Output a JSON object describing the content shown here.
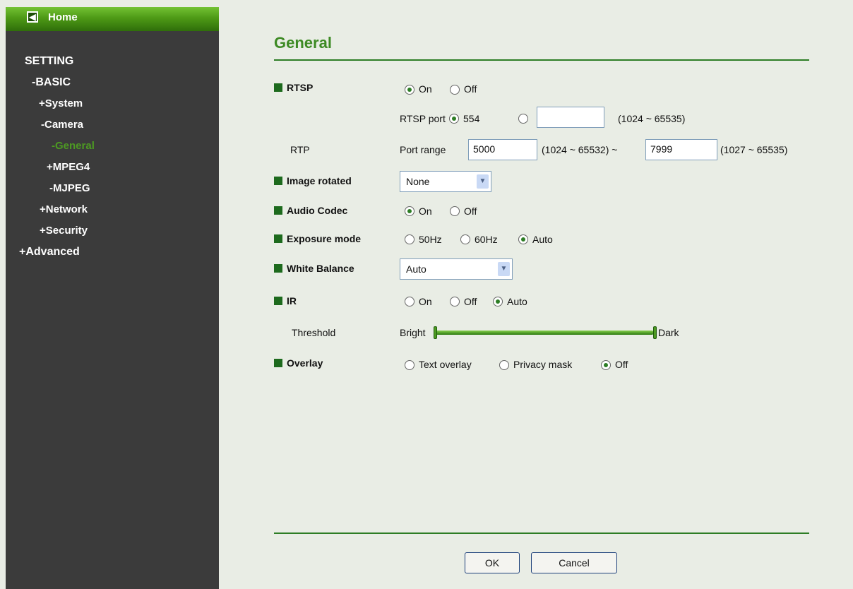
{
  "sidebar": {
    "home": "Home",
    "home_icon": "back-arrow-icon",
    "setting": "SETTING",
    "basic": "-BASIC",
    "system": "+System",
    "camera": "-Camera",
    "general": "-General",
    "mpeg4": "+MPEG4",
    "mjpeg": "-MJPEG",
    "network": "+Network",
    "security": "+Security",
    "advanced": "+Advanced",
    "active_color": "#4d9a22"
  },
  "page": {
    "title": "General"
  },
  "rtsp": {
    "label": "RTSP",
    "on": "On",
    "off": "Off",
    "selected": "On",
    "port_label": "RTSP port",
    "port_default": "554",
    "port_selected": "554",
    "custom_port": "",
    "port_range": "(1024 ~ 65535)"
  },
  "rtp": {
    "label": "RTP",
    "port_range_label": "Port range",
    "start": "5000",
    "start_range": "(1024 ~ 65532) ~",
    "end": "7999",
    "end_range": "(1027 ~ 65535)"
  },
  "image_rotated": {
    "label": "Image rotated",
    "value": "None"
  },
  "audio_codec": {
    "label": "Audio Codec",
    "on": "On",
    "off": "Off",
    "selected": "On"
  },
  "exposure_mode": {
    "label": "Exposure mode",
    "opt1": "50Hz",
    "opt2": "60Hz",
    "opt3": "Auto",
    "selected": "Auto"
  },
  "white_balance": {
    "label": "White Balance",
    "value": "Auto"
  },
  "ir": {
    "label": "IR",
    "on": "On",
    "off": "Off",
    "auto": "Auto",
    "selected": "Auto"
  },
  "threshold": {
    "label": "Threshold",
    "left": "Bright",
    "right": "Dark"
  },
  "overlay": {
    "label": "Overlay",
    "opt1": "Text overlay",
    "opt2": "Privacy mask",
    "opt3": "Off",
    "selected": "Off"
  },
  "buttons": {
    "ok": "OK",
    "cancel": "Cancel"
  },
  "colors": {
    "accent": "#2d7d25",
    "sidebar_bg": "#3b3b3b",
    "page_bg": "#e9ede5"
  }
}
